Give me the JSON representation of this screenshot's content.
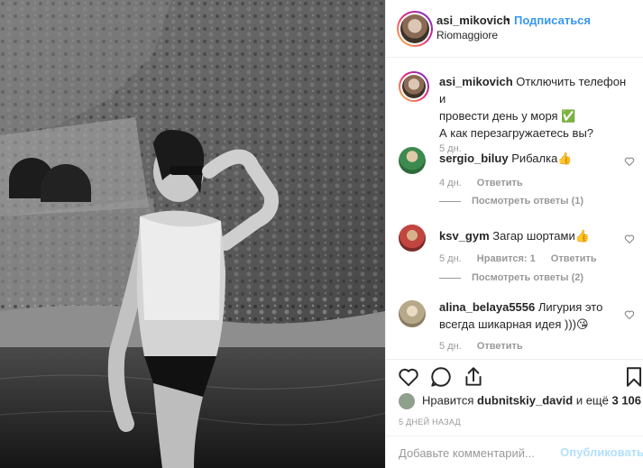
{
  "post": {
    "author": "asi_mikovich",
    "separator": "•",
    "follow_label": "Подписаться",
    "location": "Riomaggiore",
    "caption_line1": "Отключить телефон и",
    "caption_line2": "провести день у моря ✅",
    "caption_line3": "А как перезагружаетесь вы?",
    "caption_age": "5 дн."
  },
  "comments": [
    {
      "user": "sergio_biluy",
      "text": "Рибалка👍",
      "age": "4 дн.",
      "reply_label": "Ответить",
      "likes_label": "",
      "view_replies": "Посмотреть ответы (1)"
    },
    {
      "user": "ksv_gym",
      "text": "Загар шортами👍",
      "age": "5 дн.",
      "reply_label": "Ответить",
      "likes_label": "Нравится: 1",
      "view_replies": "Посмотреть ответы (2)"
    },
    {
      "user": "alina_belaya5556",
      "text_line1": "Лигурия это",
      "text_line2": "всегда шикарная идея )))😘",
      "age": "5 дн.",
      "reply_label": "Ответить"
    }
  ],
  "likes": {
    "prefix": "Нравится",
    "user": "dubnitskiy_david",
    "suffix": "и ещё",
    "count": "3 106"
  },
  "date": "5 ДНЕЙ НАЗАД",
  "add_comment": {
    "placeholder": "Добавьте комментарий...",
    "post_label": "Опубликовать"
  },
  "icons": {
    "like": "heart-icon",
    "comment": "comment-icon",
    "share": "share-icon",
    "save": "bookmark-icon"
  },
  "colors": {
    "link": "#3897f0",
    "post_disabled": "#b2dffc",
    "meta": "#999999"
  }
}
